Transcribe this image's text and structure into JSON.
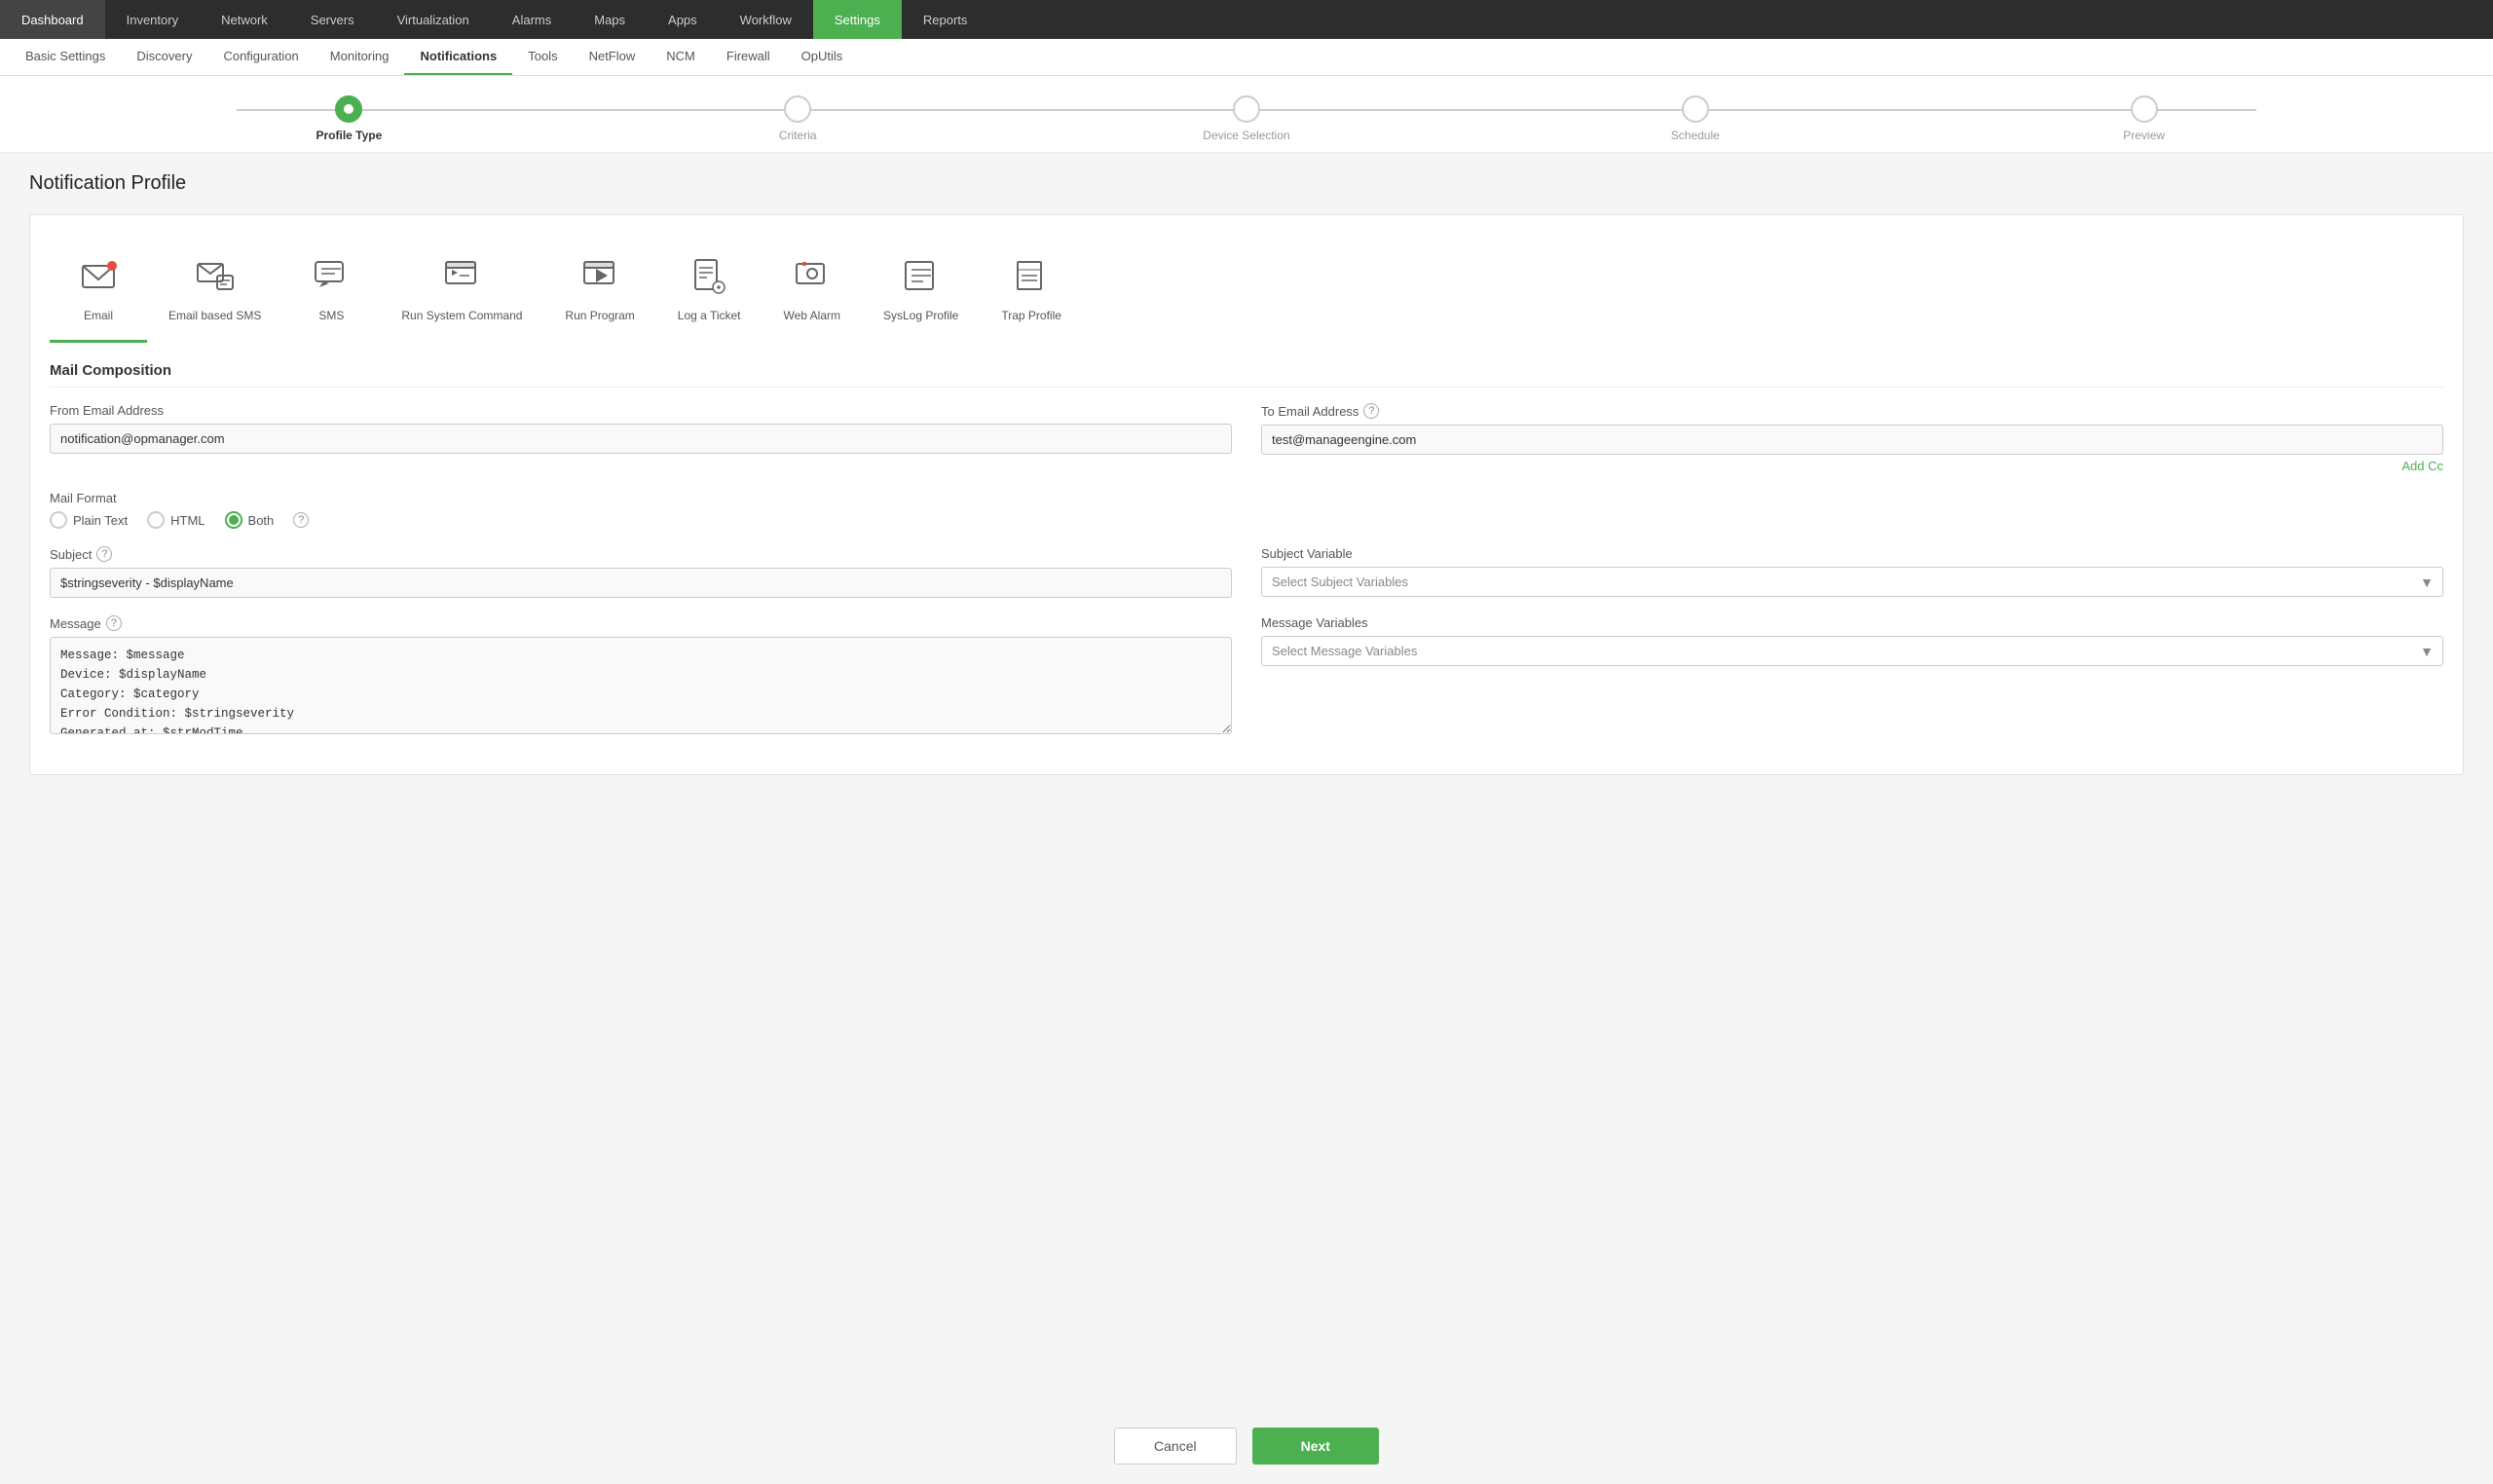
{
  "topNav": {
    "items": [
      {
        "label": "Dashboard",
        "active": false
      },
      {
        "label": "Inventory",
        "active": false
      },
      {
        "label": "Network",
        "active": false
      },
      {
        "label": "Servers",
        "active": false
      },
      {
        "label": "Virtualization",
        "active": false
      },
      {
        "label": "Alarms",
        "active": false
      },
      {
        "label": "Maps",
        "active": false
      },
      {
        "label": "Apps",
        "active": false
      },
      {
        "label": "Workflow",
        "active": false
      },
      {
        "label": "Settings",
        "active": true
      },
      {
        "label": "Reports",
        "active": false
      }
    ]
  },
  "subNav": {
    "items": [
      {
        "label": "Basic Settings",
        "active": false
      },
      {
        "label": "Discovery",
        "active": false
      },
      {
        "label": "Configuration",
        "active": false
      },
      {
        "label": "Monitoring",
        "active": false
      },
      {
        "label": "Notifications",
        "active": true
      },
      {
        "label": "Tools",
        "active": false
      },
      {
        "label": "NetFlow",
        "active": false
      },
      {
        "label": "NCM",
        "active": false
      },
      {
        "label": "Firewall",
        "active": false
      },
      {
        "label": "OpUtils",
        "active": false
      }
    ]
  },
  "progressSteps": [
    {
      "label": "Profile Type",
      "active": true
    },
    {
      "label": "Criteria",
      "active": false
    },
    {
      "label": "Device Selection",
      "active": false
    },
    {
      "label": "Schedule",
      "active": false
    },
    {
      "label": "Preview",
      "active": false
    }
  ],
  "pageTitle": "Notification Profile",
  "profileTypes": [
    {
      "label": "Email",
      "active": true
    },
    {
      "label": "Email based SMS",
      "active": false
    },
    {
      "label": "SMS",
      "active": false
    },
    {
      "label": "Run System Command",
      "active": false
    },
    {
      "label": "Run Program",
      "active": false
    },
    {
      "label": "Log a Ticket",
      "active": false
    },
    {
      "label": "Web Alarm",
      "active": false
    },
    {
      "label": "SysLog Profile",
      "active": false
    },
    {
      "label": "Trap Profile",
      "active": false
    }
  ],
  "mailComposition": {
    "sectionTitle": "Mail Composition",
    "fromEmailLabel": "From Email Address",
    "fromEmailValue": "notification@opmanager.com",
    "toEmailLabel": "To Email Address",
    "toEmailValue": "test@manageengine.com",
    "addCcLabel": "Add Cc",
    "mailFormatLabel": "Mail Format",
    "mailFormatOptions": [
      {
        "label": "Plain Text",
        "checked": false
      },
      {
        "label": "HTML",
        "checked": false
      },
      {
        "label": "Both",
        "checked": true
      }
    ],
    "subjectLabel": "Subject",
    "subjectValue": "$stringseverity - $displayName",
    "subjectVariableLabel": "Subject Variable",
    "subjectVariablePlaceholder": "Select Subject Variables",
    "messageLabel": "Message",
    "messageValue": "Message: $message\nDevice: $displayName\nCategory: $category\nError Condition: $stringseverity\nGenerated at: $strModTime",
    "messageVariableLabel": "Message Variables",
    "messageVariablePlaceholder": "Select Message Variables"
  },
  "footer": {
    "cancelLabel": "Cancel",
    "nextLabel": "Next"
  }
}
